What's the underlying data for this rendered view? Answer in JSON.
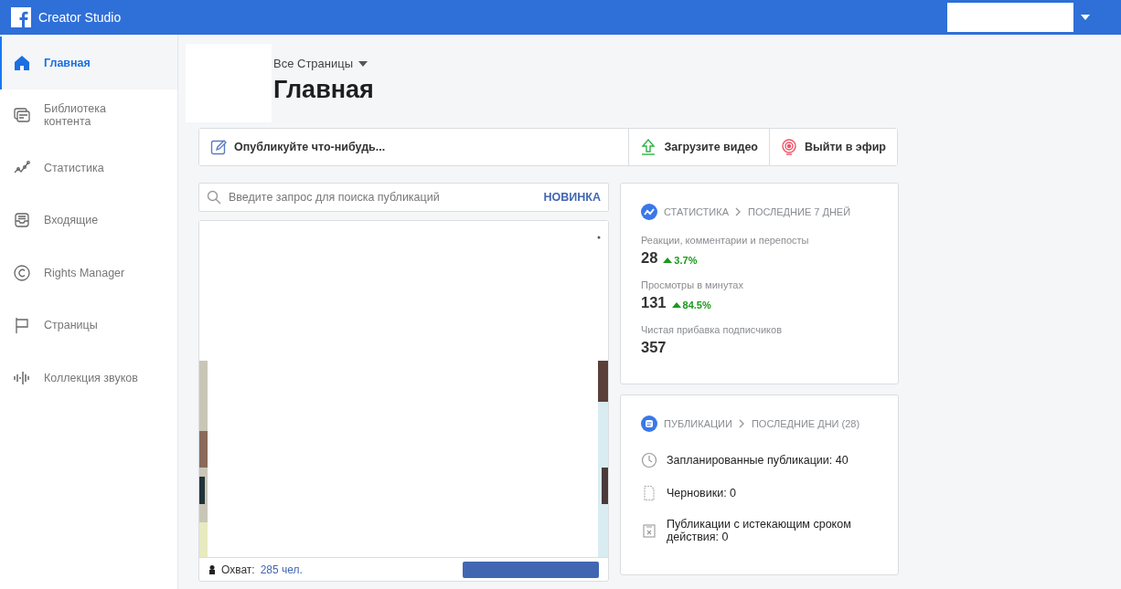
{
  "topbar": {
    "title": "Creator Studio"
  },
  "sidebar": {
    "items": [
      {
        "label": "Главная",
        "kind": "home",
        "selected": true
      },
      {
        "label": "Библиотека контента",
        "kind": "library",
        "selected": false
      },
      {
        "label": "Статистика",
        "kind": "stats",
        "selected": false
      },
      {
        "label": "Входящие",
        "kind": "inbox",
        "selected": false
      },
      {
        "label": "Rights Manager",
        "kind": "copyright",
        "selected": false
      },
      {
        "label": "Страницы",
        "kind": "flag",
        "selected": false
      },
      {
        "label": "Коллекция звуков",
        "kind": "sound",
        "selected": false
      }
    ]
  },
  "header": {
    "page_selector": "Все Страницы",
    "title": "Главная"
  },
  "actions": [
    {
      "label": "Опубликуйте что-нибудь...",
      "kind": "edit"
    },
    {
      "label": "Загрузите видео",
      "kind": "upload"
    },
    {
      "label": "Выйти в эфир",
      "kind": "live"
    }
  ],
  "search": {
    "placeholder": "Введите запрос для поиска публикаций",
    "badge": "НОВИНКА"
  },
  "post": {
    "reach_label": "Охват:",
    "reach_value": "285 чел."
  },
  "stats_card": {
    "title": "СТАТИСТИКА",
    "period": "ПОСЛЕДНИЕ 7 ДНЕЙ",
    "metrics": [
      {
        "label": "Реакции, комментарии и перепосты",
        "value": "28",
        "change": "3.7%"
      },
      {
        "label": "Просмотры в минутах",
        "value": "131",
        "change": "84.5%"
      },
      {
        "label": "Чистая прибавка подписчиков",
        "value": "357"
      }
    ]
  },
  "posts_card": {
    "title": "ПУБЛИКАЦИИ",
    "period": "ПОСЛЕДНИЕ ДНИ (28)",
    "items": [
      {
        "label": "Запланированные публикации: 40",
        "kind": "clock"
      },
      {
        "label": "Черновики: 0",
        "kind": "draft"
      },
      {
        "label": "Публикации с истекающим сроком действия: 0",
        "kind": "expired"
      }
    ]
  }
}
